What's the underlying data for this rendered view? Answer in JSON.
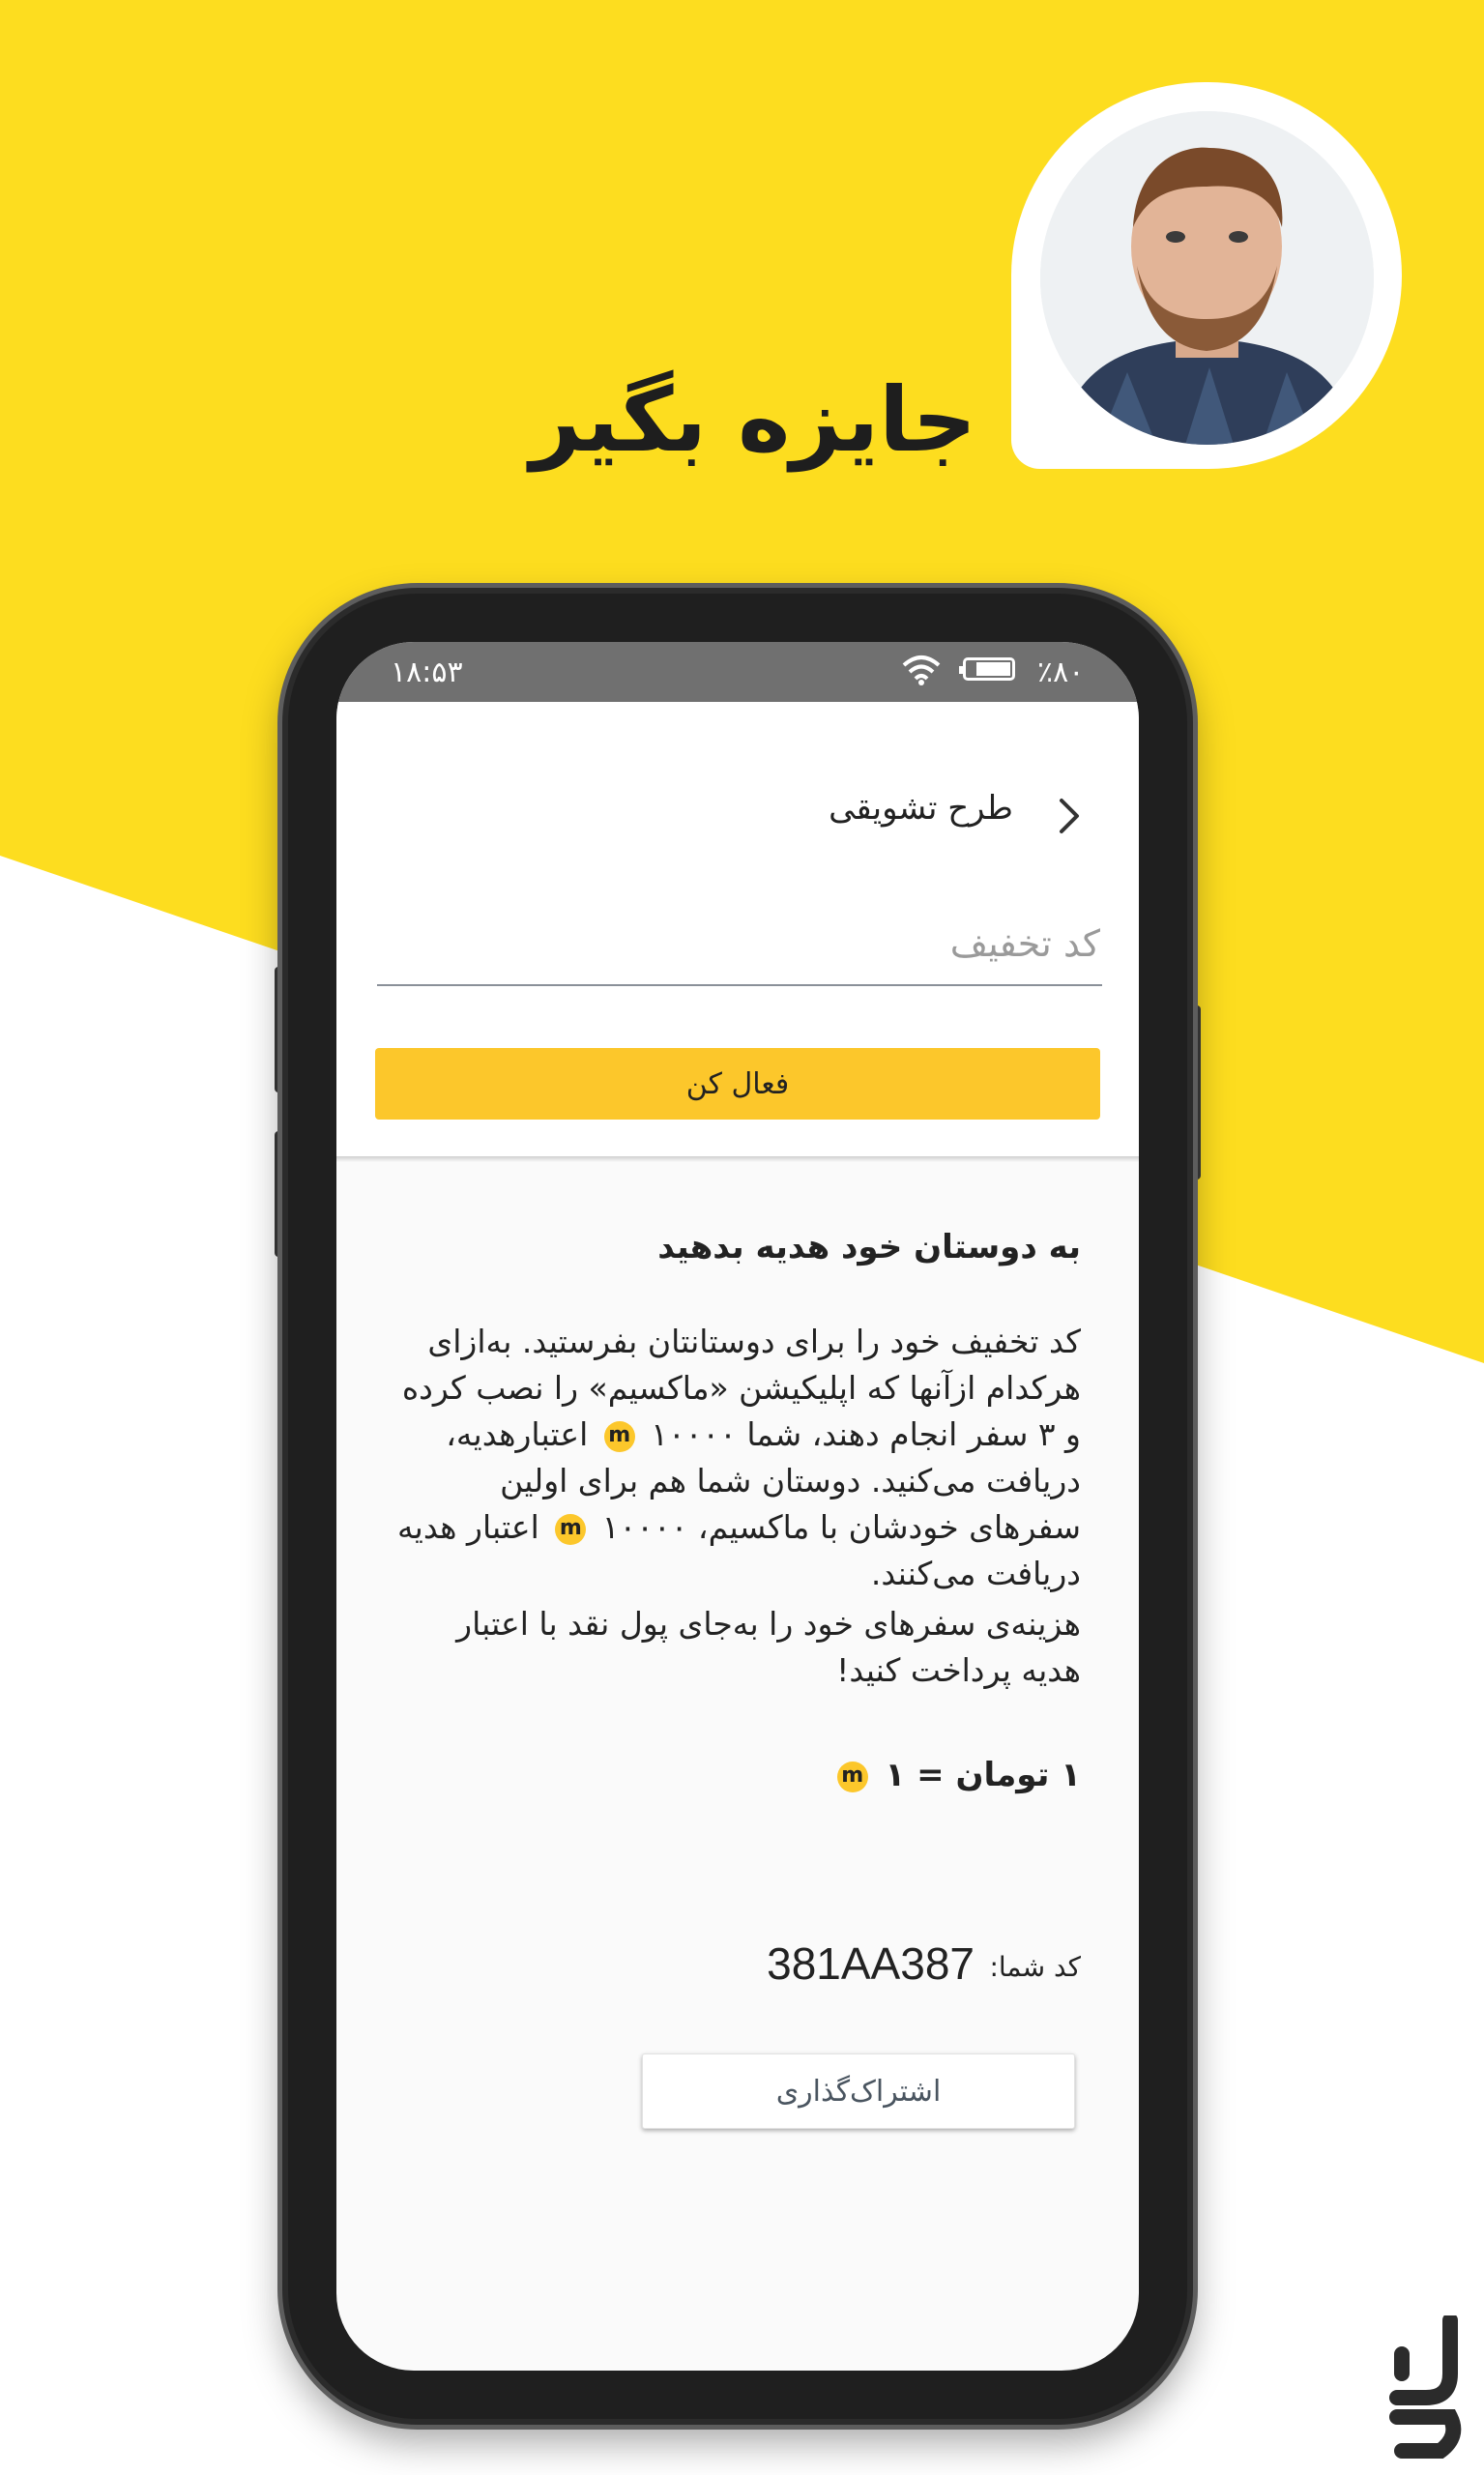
{
  "headline": "جایزه بگیر",
  "colors": {
    "accent": "#fcc72b",
    "background_yellow": "#fddd1f",
    "statusbar": "#707070"
  },
  "statusbar": {
    "time": "۱۸:۵۳",
    "battery": "٪۸۰",
    "battery_level": 0.8
  },
  "appbar": {
    "title": "طرح تشویقی",
    "back_icon": "chevron-right-icon"
  },
  "promo": {
    "code_placeholder": "کد تخفیف",
    "activate_label": "فعال کن"
  },
  "invite": {
    "title": "به دوستان خود هدیه بدهید",
    "p1_a": "کد تخفیف خود را برای دوستانتان بفرستید. به‌ازای هرکدام ازآنها که اپلیکیشن «ماکسیم» را نصب کرده و ۳ سفر انجام دهند، شما ۱۰۰۰۰",
    "p1_b": "اعتبارهدیه، دریافت می‌کنید. دوستان شما هم برای اولین سفرهای خودشان با ماکسیم، ۱۰۰۰۰",
    "p1_c": "اعتبار هدیه دریافت می‌کنند.",
    "p2": "هزینه‌ی سفرهای خود را به‌جای پول نقد با اعتبار هدیه پرداخت کنید!",
    "rate_a": "۱ تومان = ۱",
    "coin_symbol": "m"
  },
  "your_code": {
    "label": "کد شما:",
    "value": "381AA387"
  },
  "share_label": "اشتراک‌گذاری"
}
